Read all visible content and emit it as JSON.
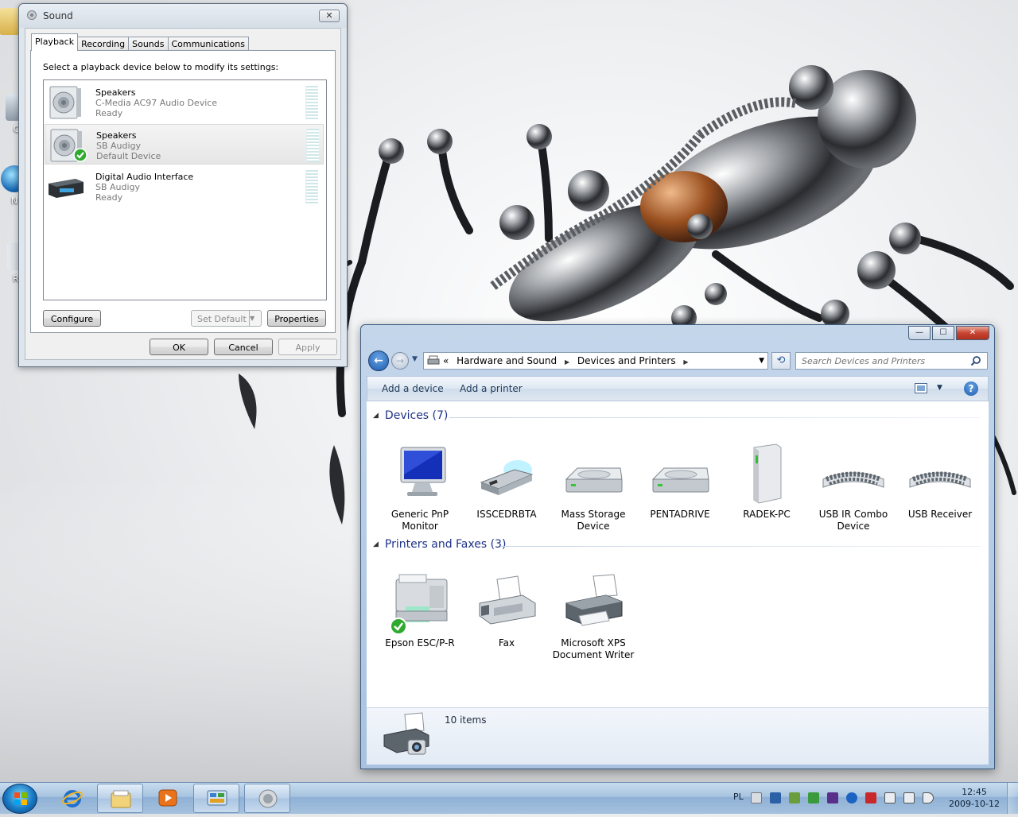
{
  "desktop": {
    "icons": [
      {
        "label": "",
        "icon": "folder-icon"
      },
      {
        "label": "Co",
        "icon": "computer-icon"
      },
      {
        "label": "N",
        "icon": "network-icon"
      },
      {
        "label": "Rec",
        "icon": "recycle-bin-icon"
      }
    ]
  },
  "sound_dialog": {
    "title": "Sound",
    "close_label": "✕",
    "tabs": [
      {
        "label": "Playback",
        "active": true
      },
      {
        "label": "Recording",
        "active": false
      },
      {
        "label": "Sounds",
        "active": false
      },
      {
        "label": "Communications",
        "active": false
      }
    ],
    "instructions": "Select a playback device below to modify its settings:",
    "devices": [
      {
        "name": "Speakers",
        "description": "C-Media AC97 Audio Device",
        "status": "Ready",
        "icon": "speaker-icon",
        "default": false,
        "selected": false
      },
      {
        "name": "Speakers",
        "description": "SB Audigy",
        "status": "Default Device",
        "icon": "speaker-icon",
        "default": true,
        "selected": true
      },
      {
        "name": "Digital Audio Interface",
        "description": "SB Audigy",
        "status": "Ready",
        "icon": "digital-audio-icon",
        "default": false,
        "selected": false
      }
    ],
    "buttons": {
      "configure": "Configure",
      "set_default": "Set Default",
      "properties": "Properties",
      "ok": "OK",
      "cancel": "Cancel",
      "apply": "Apply"
    }
  },
  "devices_window": {
    "caption": {
      "minimize": "—",
      "maximize": "☐",
      "close": "✕"
    },
    "breadcrumbs": [
      "Hardware and Sound",
      "Devices and Printers"
    ],
    "breadcrumb_prefix": "«",
    "search_placeholder": "Search Devices and Printers",
    "commands": {
      "add_device": "Add a device",
      "add_printer": "Add a printer",
      "help": "?"
    },
    "groups": {
      "devices": {
        "header": "Devices (7)",
        "items": [
          {
            "label": "Generic PnP Monitor",
            "icon": "monitor-icon"
          },
          {
            "label": "ISSCEDRBTA",
            "icon": "usb-bluetooth-icon"
          },
          {
            "label": "Mass Storage Device",
            "icon": "drive-icon"
          },
          {
            "label": "PENTADRIVE",
            "icon": "drive-icon"
          },
          {
            "label": "RADEK-PC",
            "icon": "computer-tower-icon"
          },
          {
            "label": "USB IR Combo Device",
            "icon": "keyboard-icon"
          },
          {
            "label": "USB Receiver",
            "icon": "keyboard-icon"
          }
        ]
      },
      "printers": {
        "header": "Printers and Faxes (3)",
        "items": [
          {
            "label": "Epson ESC/P-R",
            "icon": "printer-icon",
            "default": true
          },
          {
            "label": "Fax",
            "icon": "fax-icon",
            "default": false
          },
          {
            "label": "Microsoft XPS Document Writer",
            "icon": "printer-icon",
            "default": false
          }
        ]
      }
    },
    "details": {
      "count": "10 items"
    }
  },
  "taskbar": {
    "language": "PL",
    "time": "12:45",
    "date": "2009-10-12",
    "pinned": [
      "internet-explorer-icon",
      "explorer-folder-icon",
      "media-player-icon",
      "control-panel-icon",
      "sound-icon"
    ]
  },
  "colors": {
    "accent": "#1e3287",
    "taskbar": "#a7c3df",
    "check_green": "#2faa2f"
  }
}
